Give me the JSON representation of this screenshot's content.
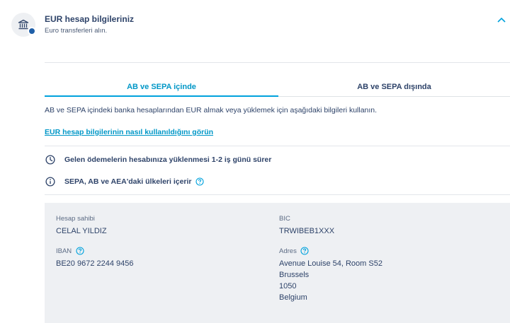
{
  "header": {
    "title": "EUR hesap bilgileriniz",
    "subtitle": "Euro transferleri alın.",
    "icons": {
      "bank": "bank-icon",
      "flag": "eu-flag-dot",
      "toggle": "chevron-up-icon"
    }
  },
  "tabs": [
    {
      "label": "AB ve SEPA içinde",
      "selected": true
    },
    {
      "label": "AB ve SEPA dışında",
      "selected": false
    }
  ],
  "description": "AB ve SEPA içindeki banka hesaplarından EUR almak veya yüklemek için aşağıdaki bilgileri kullanın.",
  "howto_link": "EUR hesap bilgilerinin nasıl kullanıldığını görün",
  "info": [
    {
      "icon": "clock-icon",
      "text": "Gelen ödemelerin hesabınıza yüklenmesi 1-2 iş günü sürer"
    },
    {
      "icon": "info-icon",
      "text": "SEPA, AB ve AEA'daki ülkeleri içerir",
      "help": true
    }
  ],
  "details": {
    "holder": {
      "label": "Hesap sahibi",
      "value": "CELAL YILDIZ"
    },
    "bic": {
      "label": "BIC",
      "value": "TRWIBEB1XXX"
    },
    "iban": {
      "label": "IBAN",
      "value": "BE20 9672 2244 9456"
    },
    "address": {
      "label": "Adres",
      "lines": [
        "Avenue Louise 54, Room S52",
        "Brussels",
        "1050",
        "Belgium"
      ]
    }
  },
  "colors": {
    "accent": "#00a2dd",
    "text": "#2e4369",
    "panel": "#eef0f3"
  }
}
